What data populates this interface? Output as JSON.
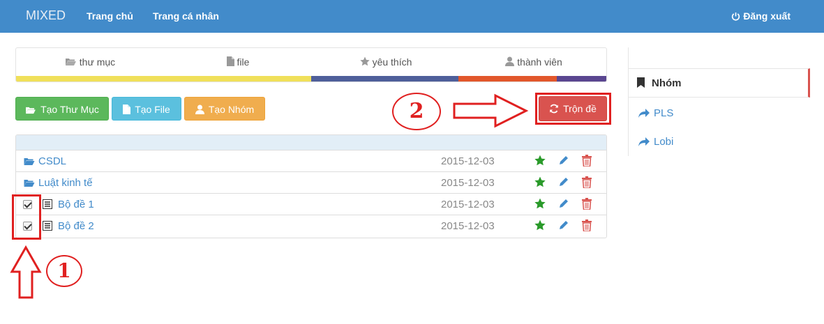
{
  "navbar": {
    "brand": "MIXED",
    "links": [
      "Trang chủ",
      "Trang cá nhân"
    ],
    "logout_label": "Đăng xuất",
    "logout_icon": "power-icon"
  },
  "stats": [
    {
      "icon": "folder-open-icon",
      "label": "thư mục",
      "color": "#f0e05a"
    },
    {
      "icon": "file-icon",
      "label": "file",
      "color": "#f0e05a"
    },
    {
      "icon": "star-icon",
      "label": "yêu thích",
      "color": "#4f5f9a"
    },
    {
      "icon": "user-icon",
      "label": "thành viên",
      "color": "#e2572b"
    }
  ],
  "stats_extra_color": "#5a4690",
  "actions": {
    "create_folder": "Tạo Thư Mục",
    "create_file": "Tạo File",
    "create_group": "Tạo Nhóm",
    "shuffle": "Trộn đề"
  },
  "table": {
    "rows": [
      {
        "type": "folder",
        "name": "CSDL",
        "date": "2015-12-03",
        "checked": false
      },
      {
        "type": "folder",
        "name": "Luật kinh tế",
        "date": "2015-12-03",
        "checked": false
      },
      {
        "type": "file",
        "name": "Bộ đề 1",
        "date": "2015-12-03",
        "checked": true
      },
      {
        "type": "file",
        "name": "Bộ đề 2",
        "date": "2015-12-03",
        "checked": true
      }
    ]
  },
  "sidebar": {
    "heading": "Nhóm",
    "items": [
      "PLS",
      "Lobi"
    ]
  },
  "annotations": {
    "step1": "1",
    "step2": "2"
  },
  "colors": {
    "navbar": "#428bca",
    "annotation": "#e02020"
  }
}
